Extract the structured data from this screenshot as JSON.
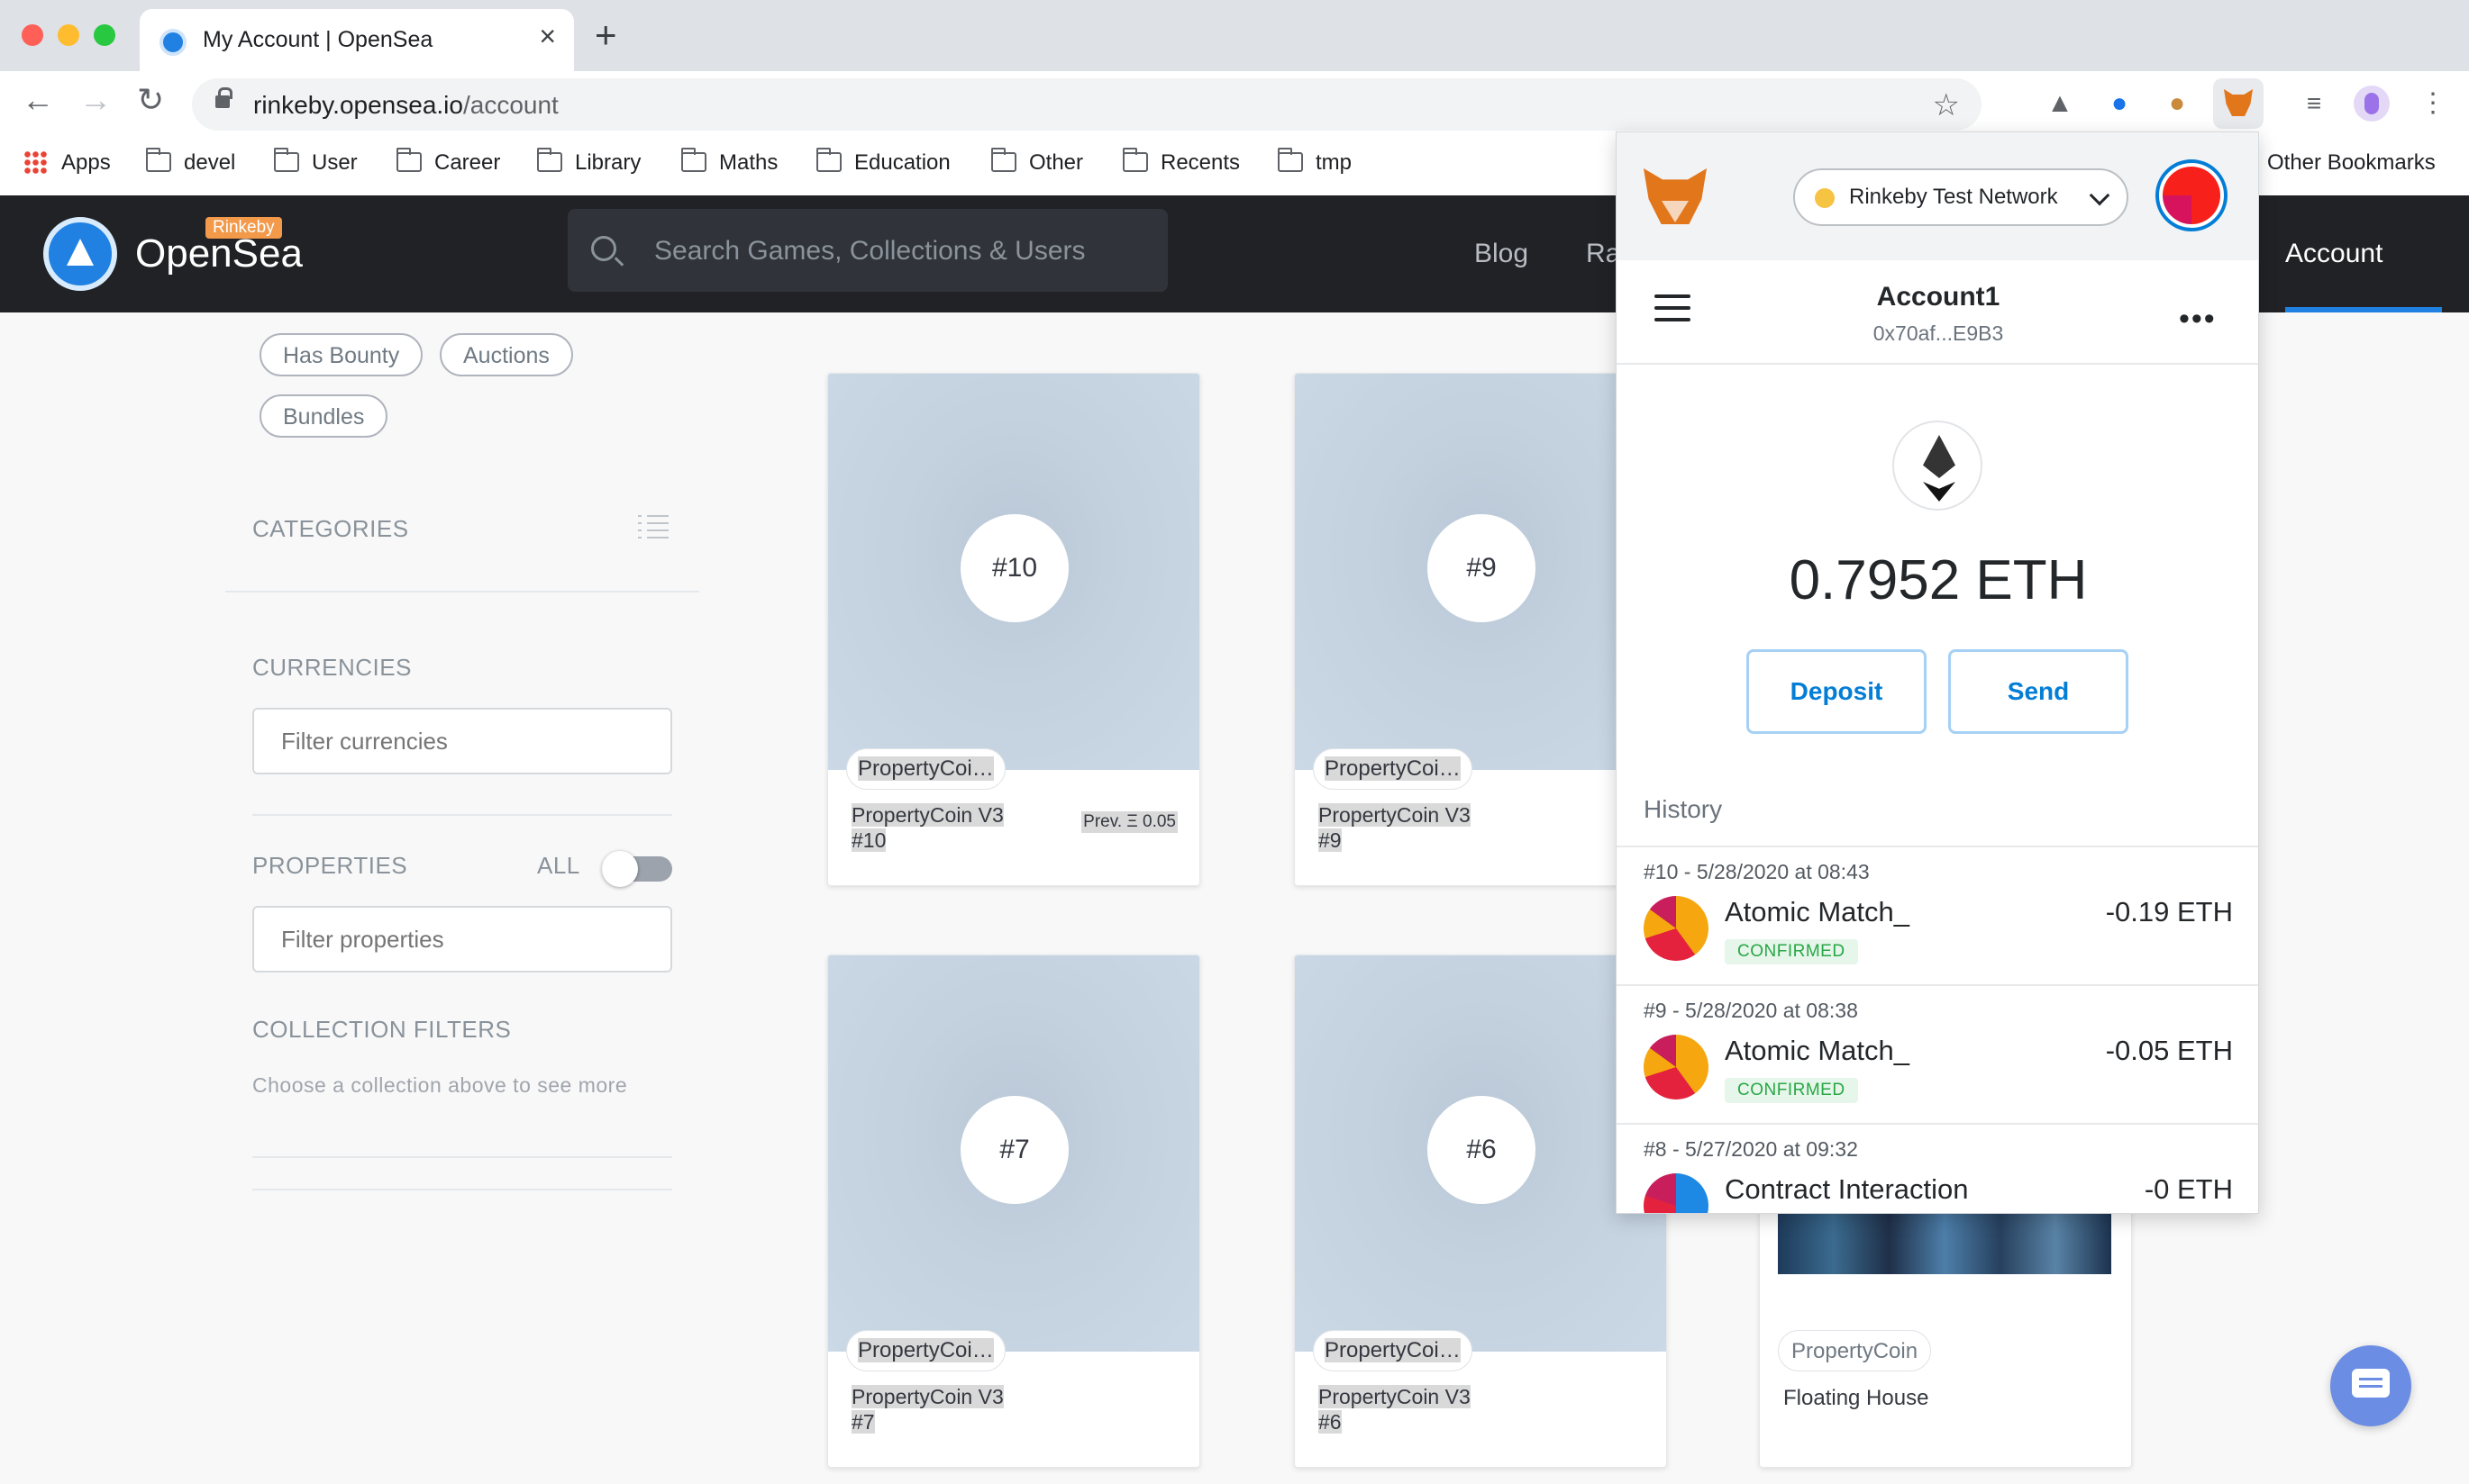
{
  "browser": {
    "tab_title": "My Account | OpenSea",
    "url_host": "rinkeby.opensea.io",
    "url_path": "/account",
    "bookmarks": [
      {
        "label": "Apps",
        "icon": "apps-grid-icon"
      },
      {
        "label": "devel",
        "icon": "folder-icon"
      },
      {
        "label": "User",
        "icon": "folder-icon"
      },
      {
        "label": "Career",
        "icon": "folder-icon"
      },
      {
        "label": "Library",
        "icon": "folder-icon"
      },
      {
        "label": "Maths",
        "icon": "folder-icon"
      },
      {
        "label": "Education",
        "icon": "folder-icon"
      },
      {
        "label": "Other",
        "icon": "folder-icon"
      },
      {
        "label": "Recents",
        "icon": "folder-icon"
      },
      {
        "label": "tmp",
        "icon": "folder-icon"
      }
    ],
    "other_bookmarks": "Other Bookmarks"
  },
  "opensea": {
    "brand": "OpenSea",
    "network_badge": "Rinkeby",
    "search_placeholder": "Search Games, Collections & Users",
    "nav": {
      "blog": "Blog",
      "ra": "Ra",
      "account": "Account"
    },
    "accent": "#2081e2"
  },
  "sidebar": {
    "pills": [
      "Has Bounty",
      "Auctions",
      "Bundles"
    ],
    "categories": "CATEGORIES",
    "currencies": "CURRENCIES",
    "currencies_placeholder": "Filter currencies",
    "properties": "PROPERTIES",
    "properties_all": "ALL",
    "properties_placeholder": "Filter properties",
    "collection_filters": "COLLECTION FILTERS",
    "collection_hint": "Choose a collection above to see more"
  },
  "cards": [
    {
      "number": "#10",
      "collection": "PropertyCoi…",
      "name": "PropertyCoin V3",
      "token": "#10",
      "price": "Prev. Ξ 0.05"
    },
    {
      "number": "#9",
      "collection": "PropertyCoi…",
      "name": "PropertyCoin V3",
      "token": "#9",
      "price": ""
    },
    {
      "number": "#7",
      "collection": "PropertyCoi…",
      "name": "PropertyCoin V3",
      "token": "#7",
      "price": ""
    },
    {
      "number": "#6",
      "collection": "PropertyCoi…",
      "name": "PropertyCoin V3",
      "token": "#6",
      "price": ""
    }
  ],
  "floating_card": {
    "collection": "PropertyCoin",
    "name": "Floating House"
  },
  "metamask": {
    "network": "Rinkeby Test Network",
    "account_name": "Account1",
    "account_address": "0x70af...E9B3",
    "balance": "0.7952 ETH",
    "deposit": "Deposit",
    "send": "Send",
    "history_label": "History",
    "transactions": [
      {
        "meta": "#10 - 5/28/2020 at 08:43",
        "title": "Atomic Match_",
        "status": "CONFIRMED",
        "amount": "-0.19 ETH"
      },
      {
        "meta": "#9 - 5/28/2020 at 08:38",
        "title": "Atomic Match_",
        "status": "CONFIRMED",
        "amount": "-0.05 ETH"
      },
      {
        "meta": "#8 - 5/27/2020 at 09:32",
        "title": "Contract Interaction",
        "status": "",
        "amount": "-0 ETH"
      }
    ],
    "accent": "#037dd6",
    "confirmed_color": "#28a745"
  }
}
